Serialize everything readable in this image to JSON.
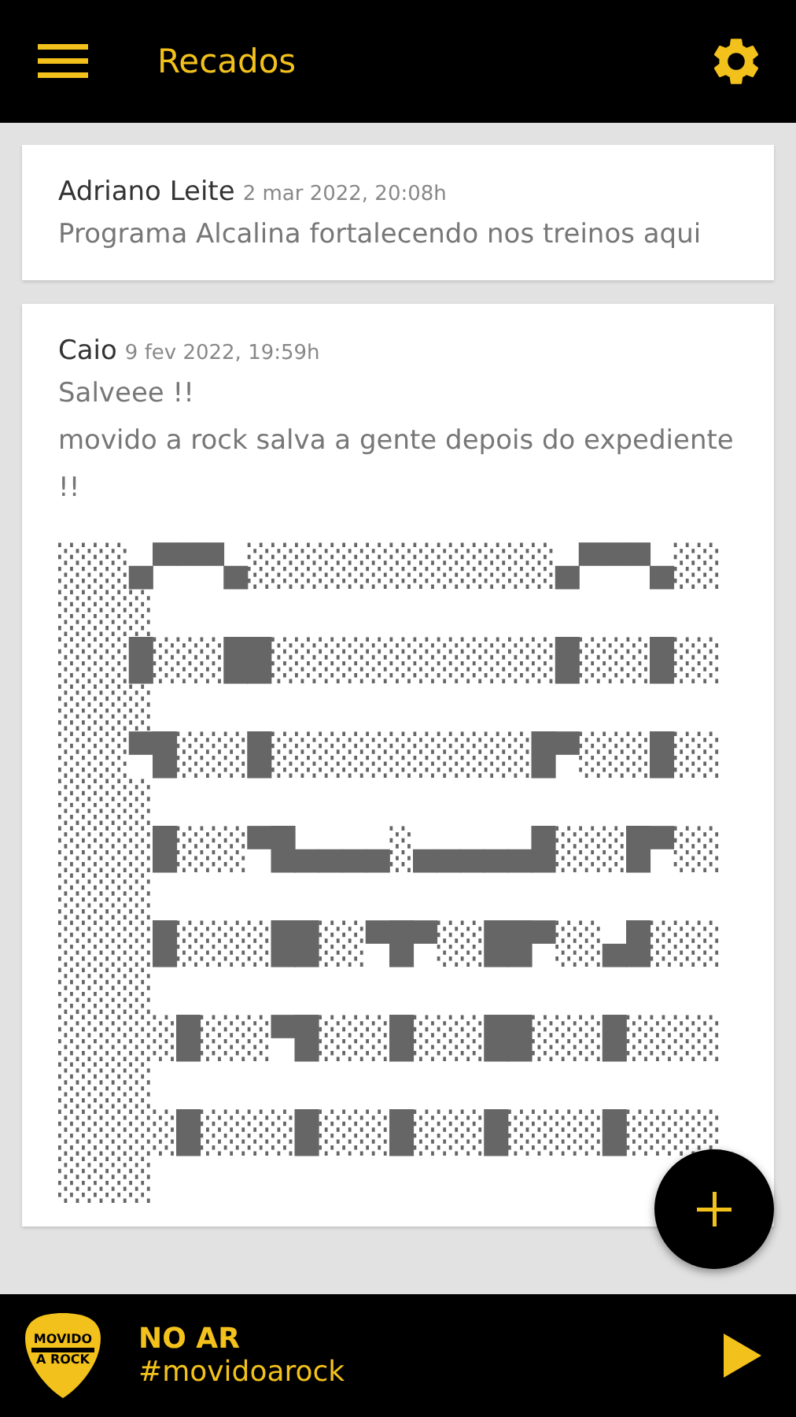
{
  "app_bar": {
    "title": "Recados"
  },
  "messages": [
    {
      "author": "Adriano Leite",
      "date": "2 mar 2022, 20:08h",
      "lines": [
        "Programa Alcalina fortalecendo nos treinos aqui"
      ]
    },
    {
      "author": "Caio",
      "date": "9 fev 2022, 19:59h",
      "lines": [
        "Salveee !!",
        "movido a rock salva a gente depois do expediente !!"
      ],
      "art_lines": [
        "░░░▄▀▀▀▄░░░░░░░░░░░░░▄▀▀▀▄░░",
        "░░░░",
        "░░░█░░░██░░░░░░░░░░░░█░░░█░░",
        "░░░░",
        "░░░▀█░░░█░░░░░░░░░░░█▀░░░█░░",
        "░░░░",
        "░░░░█░░░▀█▄▄▄▄░▄▄▄▄▄█░░░█▀░░",
        "░░░░",
        "░░░░█░░░░██░░▀█▀░░██▀░░▄█░░░",
        "░░░░",
        "░░░░░█░░░▀█░░░█░░░██░░░█░░░░",
        "░░░░",
        "░░░░░█░░░░█░░░█░░░█░░░░█░░░░",
        "░░░░"
      ]
    }
  ],
  "player": {
    "logo_lines": [
      "MOVIDO",
      "A ROCK"
    ],
    "status": "NO AR",
    "subtitle": "#movidoarock"
  }
}
